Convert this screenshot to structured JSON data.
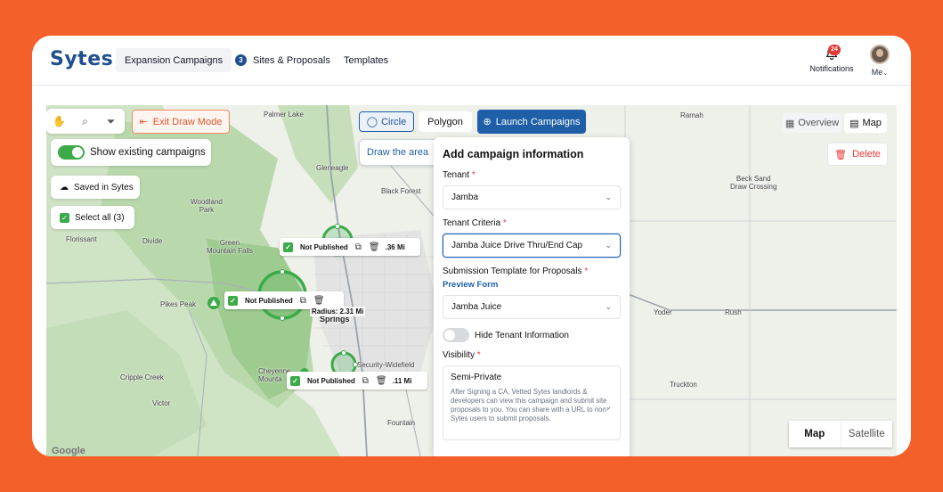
{
  "header": {
    "logo": "Sytes",
    "nav": [
      {
        "label": "Expansion Campaigns"
      },
      {
        "label": "Sites & Proposals",
        "badge": "3"
      },
      {
        "label": "Templates"
      }
    ],
    "notifications": {
      "label": "Notifications",
      "count": "24"
    },
    "user": {
      "label": "Me"
    }
  },
  "map_toolbar": {
    "exit_label": "Exit Draw Mode",
    "circle_label": "Circle",
    "polygon_label": "Polygon",
    "launch_label": "Launch Campaigns",
    "overview_label": "Overview",
    "map_label": "Map",
    "delete_label": "Delete",
    "draw_hint": "Draw the area"
  },
  "layers": {
    "show_existing_label": "Show existing campaigns",
    "show_existing_on": true,
    "saved_label": "Saved in Sytes",
    "select_all_label": "Select all (3)"
  },
  "sites": [
    {
      "status": "Not Published",
      "distance": ".36 Mi"
    },
    {
      "status": "Not Published",
      "radius": "Radius: 2.31 Mi"
    },
    {
      "status": "Not Published",
      "distance": ".11 Mi"
    }
  ],
  "places": {
    "palmer_lake": "Palmer Lake",
    "gleneagle": "Gleneagle",
    "black_forest": "Black Forest",
    "woodland_park": "Woodland\nPark",
    "florissant": "Florissant",
    "divide": "Divide",
    "green_mountain_falls": "Green\nMountain Falls",
    "pikes_peak": "Pikes Peak",
    "springs": "Springs",
    "cheyenne_mountain": "Cheyenne\nMounta",
    "security_widefield": "Security-Widefield",
    "cripple_creek": "Cripple Creek",
    "victor": "Victor",
    "fountain": "Fountain",
    "ramah": "Ramah",
    "beck_sand": "Beck Sand\nDraw Crossing",
    "yoder": "Yoder",
    "rush": "Rush",
    "truckton": "Truckton"
  },
  "panel": {
    "title": "Add campaign information",
    "tenant_label": "Tenant",
    "tenant_value": "Jamba",
    "criteria_label": "Tenant Criteria",
    "criteria_value": "Jamba Juice Drive Thru/End Cap",
    "template_label": "Submission Template for Proposals",
    "preview_link": "Preview Form",
    "template_value": "Jamba Juice",
    "hide_label": "Hide Tenant Information",
    "visibility_label": "Visibility",
    "visibility_value": "Semi-Private",
    "visibility_desc": "After Signing a CA, Vetted Sytes landlords & developers can view this campaign and submit site proposals to you. You can share with a URL to non-Sytes users to submit proposals."
  },
  "map_type": {
    "map": "Map",
    "satellite": "Satellite"
  },
  "attribution": "Google",
  "colors": {
    "brand": "#1f4f8e",
    "accent": "#1f5fa8",
    "frame": "#f4602a",
    "site": "#3daa4a",
    "danger": "#e53935"
  }
}
